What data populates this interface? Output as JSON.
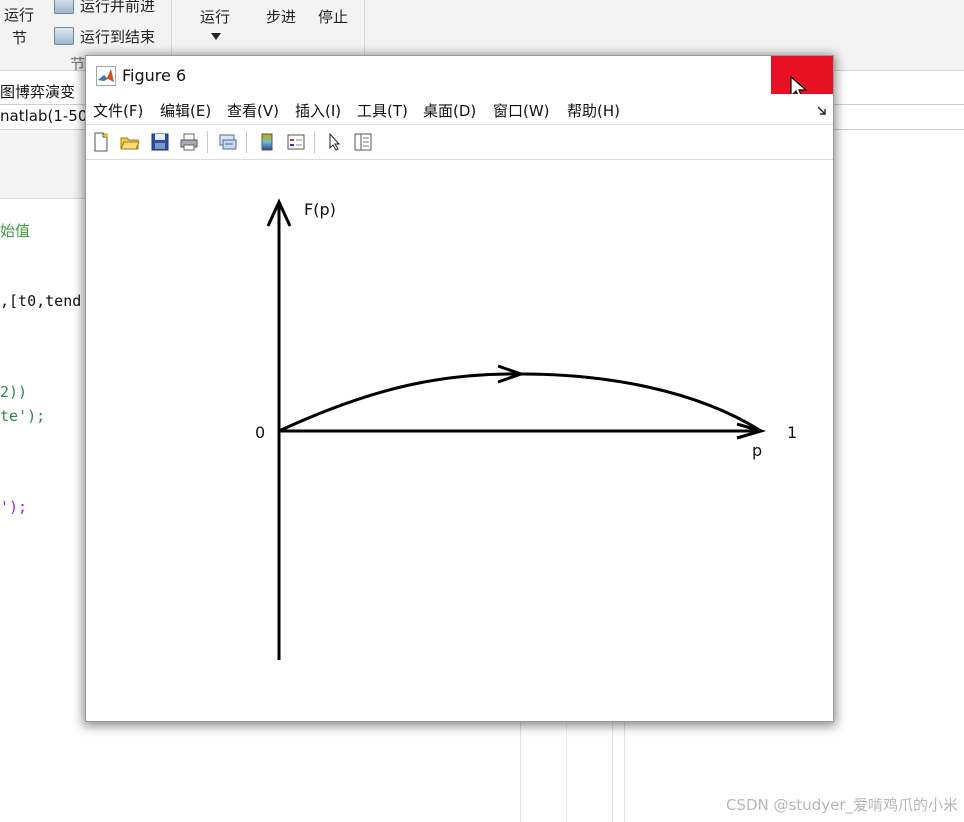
{
  "ide": {
    "ribbon": {
      "run_section_label_1": "运行",
      "run_section_label_2": "节",
      "run_advance_label": "运行并前进",
      "run_to_end_label": "运行到结束",
      "section_group_label": "节",
      "run_label": "运行",
      "step_label": "步进",
      "stop_label": "停止"
    },
    "tab_label": "图博弈演变",
    "path_text": "natlab(1-50",
    "code_lines": {
      "comment_fragment": "始值",
      "line_ode": ",[t0,tend",
      "line_paren": "2))",
      "line_string": "te');",
      "line_end": "');"
    }
  },
  "figure": {
    "title": "Figure 6",
    "menus": [
      "文件(F)",
      "编辑(E)",
      "查看(V)",
      "插入(I)",
      "工具(T)",
      "桌面(D)",
      "窗口(W)",
      "帮助(H)"
    ],
    "toolbar": [
      "new-figure-icon",
      "open-file-icon",
      "save-icon",
      "print-icon",
      "link-icon",
      "colorbar-icon",
      "legend-icon",
      "pointer-icon",
      "property-editor-icon"
    ],
    "plot": {
      "y_label": "F(p)",
      "origin_label": "0",
      "x_end_label": "1",
      "x_label": "p",
      "line_color": "#000000"
    }
  },
  "watermark": "CSDN @studyer_爱啃鸡爪的小米",
  "colors": {
    "close_button": "#e81123",
    "comment_green": "#3c9b3c",
    "code_green": "#2e8b57",
    "code_purple": "#a020f0"
  }
}
